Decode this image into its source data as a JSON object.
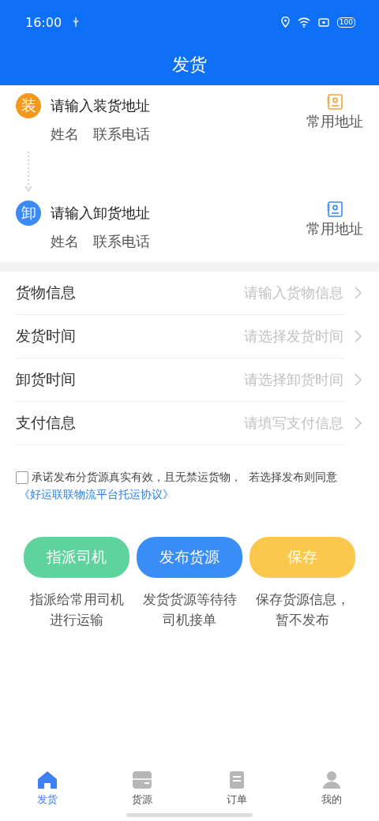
{
  "status_bar": {
    "time": "16:00",
    "battery": "100"
  },
  "title": "发货",
  "addresses": [
    {
      "kind": "load",
      "badge": "装",
      "color": "#f39a1e",
      "placeholder": "请输入装货地址",
      "name": "姓名",
      "phone": "联系电话",
      "shortcut": "常用地址"
    },
    {
      "kind": "unload",
      "badge": "卸",
      "color": "#3d8af7",
      "placeholder": "请输入卸货地址",
      "name": "姓名",
      "phone": "联系电话",
      "shortcut": "常用地址"
    }
  ],
  "form": [
    {
      "label": "货物信息",
      "placeholder": "请输入货物信息"
    },
    {
      "label": "发货时间",
      "placeholder": "请选择发货时间"
    },
    {
      "label": "卸货时间",
      "placeholder": "请选择卸货时间"
    },
    {
      "label": "支付信息",
      "placeholder": "请填写支付信息"
    }
  ],
  "agreement": {
    "checked": false,
    "text": "承诺发布分货源真实有效，且无禁运货物，  若选择发布则同意",
    "link": "《好运联联物流平台托运协议》"
  },
  "actions": [
    {
      "label": "指派司机",
      "color": "#5fd39d",
      "note": "指派给常用司机进行运输"
    },
    {
      "label": "发布货源",
      "color": "#3a8cf6",
      "note": "发货货源等待待司机接单"
    },
    {
      "label": "保存",
      "color": "#fbc84e",
      "note": "保存货源信息，暂不发布"
    }
  ],
  "tabs": [
    {
      "kind": "home",
      "label": "发货",
      "selected": true
    },
    {
      "kind": "box",
      "label": "货源",
      "selected": false
    },
    {
      "kind": "order",
      "label": "订单",
      "selected": false
    },
    {
      "kind": "user",
      "label": "我的",
      "selected": false
    }
  ]
}
